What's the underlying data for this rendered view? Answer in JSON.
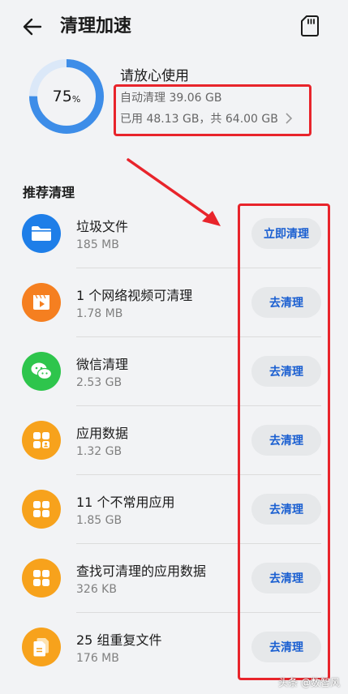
{
  "header": {
    "title": "清理加速",
    "back_icon": "arrow-left-icon",
    "sd_icon": "sd-card-icon"
  },
  "storage": {
    "percent": "75",
    "percent_unit": "%",
    "percent_value": 0.75,
    "title": "请放心使用",
    "auto_clean": "自动清理 39.06 GB",
    "used": "已用 48.13 GB，共 64.00 GB",
    "ring_color": "#3d8de8"
  },
  "section": {
    "title": "推荐清理"
  },
  "items": [
    {
      "name": "垃圾文件",
      "size": "185 MB",
      "action": "立即清理",
      "icon": "folder-icon",
      "color": "#1e7ee8"
    },
    {
      "name": "1 个网络视频可清理",
      "size": "1.78 MB",
      "action": "去清理",
      "icon": "video-icon",
      "color": "#f57f20"
    },
    {
      "name": "微信清理",
      "size": "2.53 GB",
      "action": "去清理",
      "icon": "wechat-icon",
      "color": "#2ec54c"
    },
    {
      "name": "应用数据",
      "size": "1.32 GB",
      "action": "去清理",
      "icon": "app-data-icon",
      "color": "#f7a21c"
    },
    {
      "name": "11 个不常用应用",
      "size": "1.85 GB",
      "action": "去清理",
      "icon": "apps-grid-icon",
      "color": "#f7a21c"
    },
    {
      "name": "查找可清理的应用数据",
      "size": "326 KB",
      "action": "去清理",
      "icon": "apps-grid-icon",
      "color": "#f7a21c"
    },
    {
      "name": "25 组重复文件",
      "size": "176 MB",
      "action": "去清理",
      "icon": "duplicate-files-icon",
      "color": "#f7a21c"
    }
  ],
  "watermark": "头条 @数智风"
}
